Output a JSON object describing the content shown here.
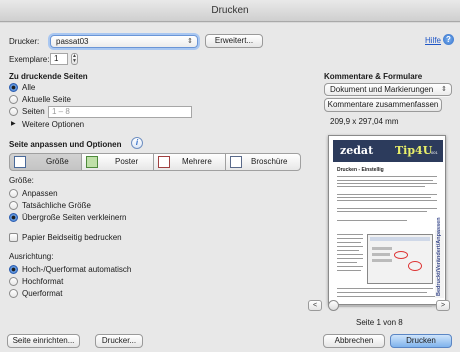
{
  "window": {
    "title": "Drucken"
  },
  "printer": {
    "label": "Drucker:",
    "value": "passat03",
    "advanced_button": "Erweitert...",
    "help_link": "Hilfe"
  },
  "copies": {
    "label": "Exemplare:",
    "value": "1"
  },
  "pages": {
    "heading": "Zu druckende Seiten",
    "options": [
      "Alle",
      "Aktuelle Seite",
      "Seiten"
    ],
    "selected": 0,
    "range_placeholder": "1 – 8",
    "more_options": "Weitere Optionen"
  },
  "sizing": {
    "heading": "Seite anpassen und Optionen",
    "tabs": [
      "Größe",
      "Poster",
      "Mehrere",
      "Broschüre"
    ],
    "selected_tab": 0,
    "size_label": "Größe:",
    "size_options": [
      "Anpassen",
      "Tatsächliche Größe",
      "Übergroße Seiten verkleinern"
    ],
    "size_selected": 2,
    "duplex_label": "Papier Beidseitig bedrucken",
    "orientation_label": "Ausrichtung:",
    "orientation_options": [
      "Hoch-/Querformat automatisch",
      "Hochformat",
      "Querformat"
    ],
    "orientation_selected": 0
  },
  "comments": {
    "heading": "Kommentare & Formulare",
    "value": "Dokument und Markierungen",
    "summarize_button": "Kommentare zusammenfassen",
    "page_size": "209,9 x 297,04 mm"
  },
  "preview": {
    "brand_left": "zedat",
    "brand_right": "Tip4U",
    "brand_suffix": "001",
    "doc_title": "Drucken - Einstellig",
    "side_text": "Bedruckt/Verändert/Anpassen",
    "page_label": "Seite 1 von 8",
    "prev_icon": "<",
    "next_icon": ">"
  },
  "footer": {
    "page_setup_button": "Seite einrichten...",
    "printer_button": "Drucker...",
    "cancel_button": "Abbrechen",
    "print_button": "Drucken"
  },
  "colors": {
    "accent": "#2f6cc8",
    "link": "#1f56c6",
    "banner": "#2c3b5c"
  }
}
